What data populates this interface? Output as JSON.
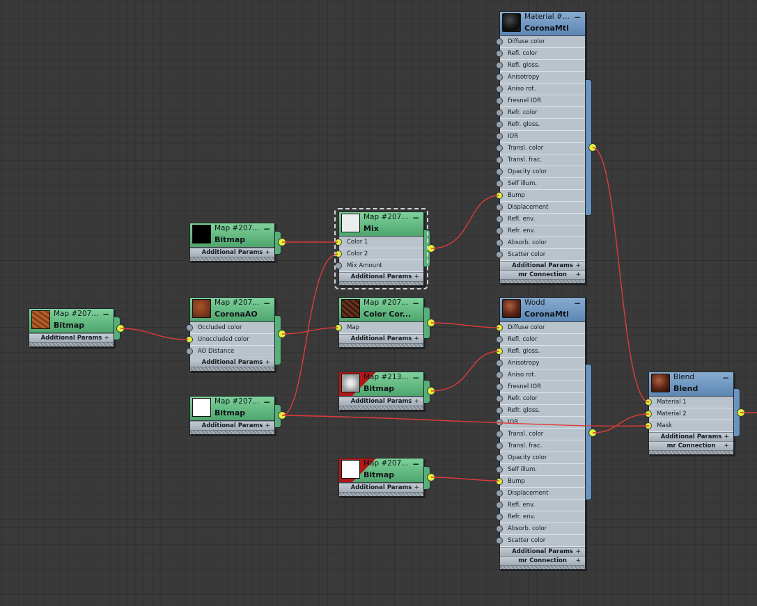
{
  "colors": {
    "wire": "#e03a3a",
    "map_header": "#5fb77f",
    "material_header": "#6e98c4",
    "socket_connected": "#e0f23a",
    "socket_empty": "#97a1ac",
    "background": "#3a3a3a"
  },
  "nodes": {
    "bitmap_left": {
      "title": "Map #207...",
      "type": "Bitmap",
      "footer": "Additional Params",
      "thumb": "wood-texture"
    },
    "bitmap_black": {
      "title": "Map #207...",
      "type": "Bitmap",
      "footer": "Additional Params",
      "thumb": "black"
    },
    "corona_ao": {
      "title": "Map #207...",
      "type": "CoronaAO",
      "slots": [
        "Occluded color",
        "Unoccluded color",
        "AO Distance"
      ],
      "footer": "Additional Params",
      "thumb": "wood-texture"
    },
    "bitmap_white": {
      "title": "Map #207...",
      "type": "Bitmap",
      "footer": "Additional Params",
      "thumb": "white"
    },
    "mix": {
      "title": "Map #207...",
      "type": "Mix",
      "slots": [
        "Color 1",
        "Color 2",
        "Mix Amount"
      ],
      "footer": "Additional Params",
      "thumb": "white"
    },
    "color_correction": {
      "title": "Map #207...",
      "type": "Color Cor...",
      "slots": [
        "Map"
      ],
      "footer": "Additional Params",
      "thumb": "dark-wood"
    },
    "bitmap_213": {
      "title": "Map #213...",
      "type": "Bitmap",
      "footer": "Additional Params",
      "thumb": "gray-noise"
    },
    "bitmap_bump": {
      "title": "Map #207...",
      "type": "Bitmap",
      "footer": "Additional Params",
      "thumb": "white"
    },
    "material_top": {
      "title": "Material #...",
      "type": "CoronaMtl",
      "slots": [
        "Diffuse color",
        "Refl. color",
        "Refl. gloss.",
        "Anisotropy",
        "Aniso rot.",
        "Fresnel IOR",
        "Refr. color",
        "Refr. gloss.",
        "IOR",
        "Transl. color",
        "Transl. frac.",
        "Opacity color",
        "Self illum.",
        "Bump",
        "Displacement",
        "Refl. env.",
        "Refr. env.",
        "Absorb. color",
        "Scatter color"
      ],
      "footer": "Additional Params",
      "footer2": "mr Connection",
      "thumb": "dark-sphere"
    },
    "material_wood": {
      "title": "Wodd",
      "type": "CoronaMtl",
      "slots": [
        "Diffuse color",
        "Refl. color",
        "Refl. gloss.",
        "Anisotropy",
        "Aniso rot.",
        "Fresnel IOR",
        "Refr. color",
        "Refr. gloss.",
        "IOR",
        "Transl. color",
        "Transl. frac.",
        "Opacity color",
        "Self illum.",
        "Bump",
        "Displacement",
        "Refl. env.",
        "Refr. env.",
        "Absorb. color",
        "Scatter color"
      ],
      "footer": "Additional Params",
      "footer2": "mr Connection",
      "thumb": "wood-sphere"
    },
    "blend": {
      "title": "Blend",
      "type": "Blend",
      "slots": [
        "Material 1",
        "Material 2",
        "Mask"
      ],
      "footer": "Additional Params",
      "footer2": "mr Connection",
      "thumb": "wood-sphere"
    }
  }
}
